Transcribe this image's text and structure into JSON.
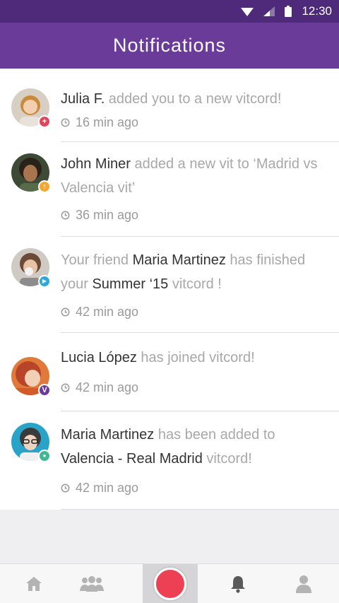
{
  "status_bar": {
    "time": "12:30"
  },
  "app_bar": {
    "title": "Notifications"
  },
  "notifications": [
    {
      "parts": [
        {
          "t": "Julia F.",
          "s": "dark"
        },
        {
          "t": " added you to a new vitcord!",
          "s": "light"
        }
      ],
      "time": "16 min ago",
      "badge": {
        "icon": "plus-icon",
        "glyph": "+",
        "color": "#e0465b"
      }
    },
    {
      "parts": [
        {
          "t": "John Miner",
          "s": "dark"
        },
        {
          "t": " added a new vit to ‘Madrid vs Valencia vit’",
          "s": "light"
        }
      ],
      "time": "36 min ago",
      "badge": {
        "icon": "upload-icon",
        "glyph": "↑",
        "color": "#f0a830"
      }
    },
    {
      "parts": [
        {
          "t": "Your friend ",
          "s": "light"
        },
        {
          "t": "Maria Martinez",
          "s": "dark"
        },
        {
          "t": " has finished your ",
          "s": "light"
        },
        {
          "t": "Summer ‘15",
          "s": "dark"
        },
        {
          "t": " vitcord !",
          "s": "light"
        }
      ],
      "time": "42 min ago",
      "badge": {
        "icon": "play-icon",
        "glyph": "▶",
        "color": "#2ea7dd"
      }
    },
    {
      "parts": [
        {
          "t": "Lucia López",
          "s": "dark"
        },
        {
          "t": " has joined vitcord!",
          "s": "light"
        }
      ],
      "time": "42 min ago",
      "badge": {
        "icon": "vitcord-v-icon",
        "glyph": "V",
        "color": "#6a3b98"
      }
    },
    {
      "parts": [
        {
          "t": "Maria Martinez",
          "s": "dark"
        },
        {
          "t": " has been added to ",
          "s": "light"
        },
        {
          "t": "Valencia - Real Madrid",
          "s": "dark"
        },
        {
          "t": " vitcord!",
          "s": "light"
        }
      ],
      "time": "42 min ago",
      "badge": {
        "icon": "person-icon",
        "glyph": "●",
        "color": "#3fb894"
      }
    }
  ],
  "bottom_nav": [
    {
      "icon": "home-icon"
    },
    {
      "icon": "group-icon"
    },
    {
      "icon": "record-icon"
    },
    {
      "icon": "bell-icon"
    },
    {
      "icon": "profile-icon"
    }
  ]
}
